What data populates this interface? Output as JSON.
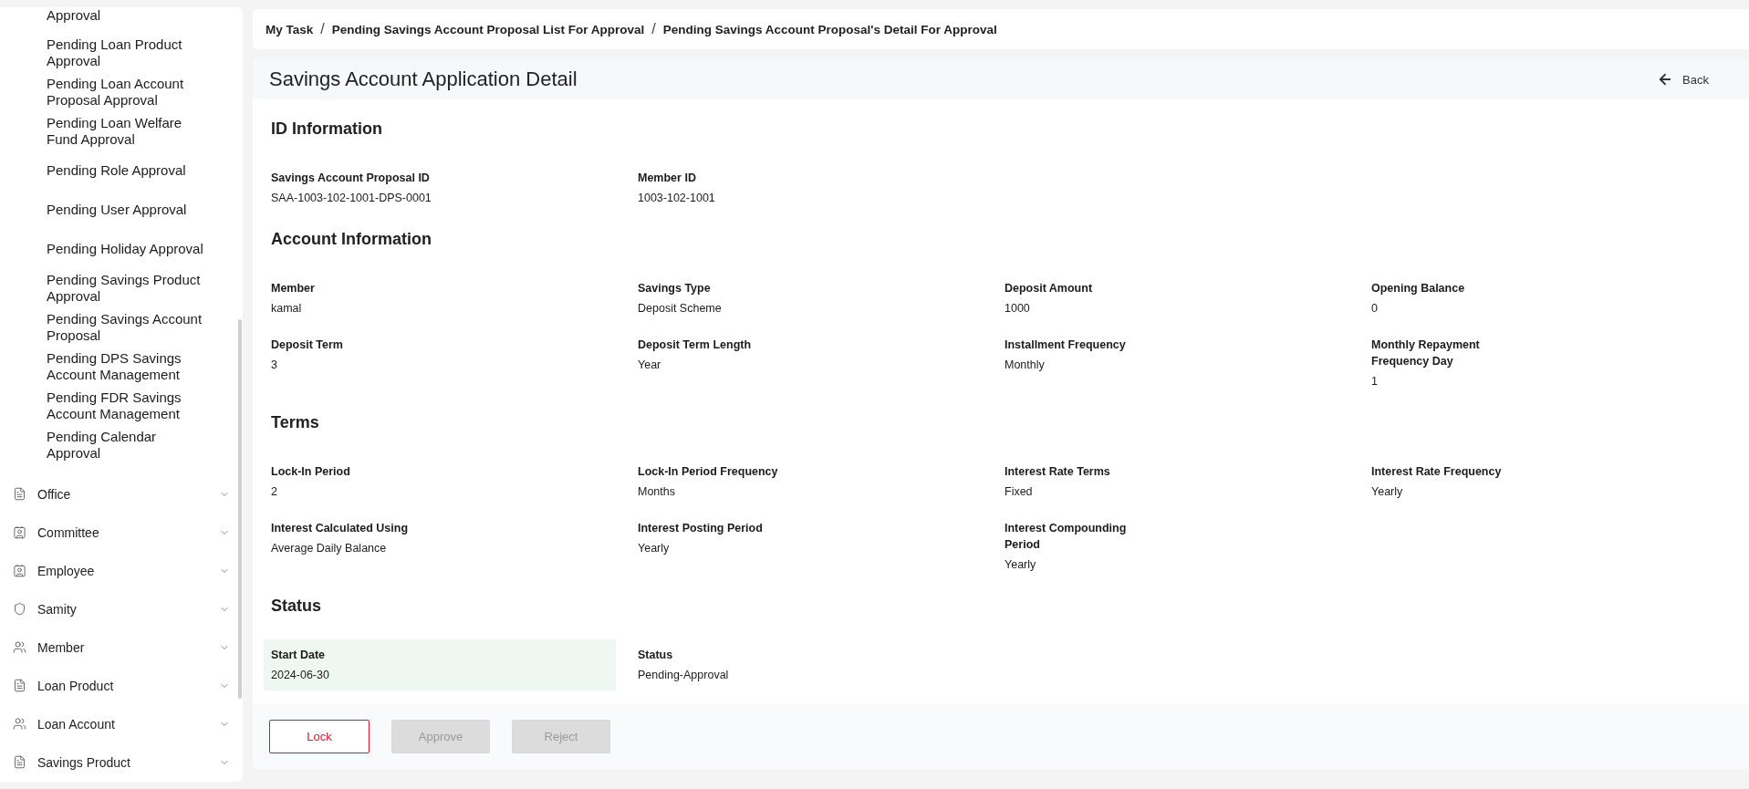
{
  "sidebar": {
    "sub_items": [
      {
        "label": "Approval"
      },
      {
        "label": "Pending Loan Product Approval"
      },
      {
        "label": "Pending Loan Account Proposal Approval"
      },
      {
        "label": "Pending Loan Welfare Fund Approval"
      },
      {
        "label": "Pending Role Approval"
      },
      {
        "label": "Pending User Approval"
      },
      {
        "label": "Pending Holiday Approval"
      },
      {
        "label": "Pending Savings Product Approval"
      },
      {
        "label": "Pending Savings Account Proposal"
      },
      {
        "label": "Pending DPS Savings Account Management"
      },
      {
        "label": "Pending FDR Savings Account Management"
      },
      {
        "label": "Pending Calendar Approval"
      }
    ],
    "items": [
      {
        "label": "Office",
        "kind": "document",
        "expanded": false
      },
      {
        "label": "Committee",
        "kind": "card",
        "expanded": false
      },
      {
        "label": "Employee",
        "kind": "card",
        "expanded": false
      },
      {
        "label": "Samity",
        "kind": "samity",
        "expanded": false
      },
      {
        "label": "Member",
        "kind": "group",
        "expanded": false
      },
      {
        "label": "Loan Product",
        "kind": "document",
        "expanded": false
      },
      {
        "label": "Loan Account",
        "kind": "group",
        "expanded": false
      },
      {
        "label": "Savings Product",
        "kind": "document",
        "expanded": false
      }
    ]
  },
  "breadcrumb": {
    "separator": "/",
    "items": [
      "My Task",
      "Pending Savings Account Proposal List For Approval",
      "Pending Savings Account Proposal's Detail For Approval"
    ]
  },
  "page": {
    "title": "Savings Account Application Detail",
    "back_label": "Back"
  },
  "sections": [
    {
      "title": "ID Information",
      "fields": [
        {
          "label": "Savings Account Proposal ID",
          "value": "SAA-1003-102-1001-DPS-0001",
          "highlighted": false
        },
        {
          "label": "Member ID",
          "value": "1003-102-1001",
          "highlighted": false
        }
      ]
    },
    {
      "title": "Account Information",
      "fields": [
        {
          "label": "Member",
          "value": "kamal",
          "highlighted": false
        },
        {
          "label": "Savings Type",
          "value": "Deposit Scheme",
          "highlighted": false
        },
        {
          "label": "Deposit Amount",
          "value": "1000",
          "highlighted": false
        },
        {
          "label": "Opening Balance",
          "value": "0",
          "highlighted": false
        },
        {
          "label": "Deposit Term",
          "value": "3",
          "highlighted": false
        },
        {
          "label": "Deposit Term Length",
          "value": "Year",
          "highlighted": false
        },
        {
          "label": "Installment Frequency",
          "value": "Monthly",
          "highlighted": false
        },
        {
          "label": "Monthly Repayment Frequency Day",
          "value": "1",
          "highlighted": false
        }
      ]
    },
    {
      "title": "Terms",
      "fields": [
        {
          "label": "Lock-In Period",
          "value": "2",
          "highlighted": false
        },
        {
          "label": "Lock-In Period Frequency",
          "value": "Months",
          "highlighted": false
        },
        {
          "label": "Interest Rate Terms",
          "value": "Fixed",
          "highlighted": false
        },
        {
          "label": "Interest Rate Frequency",
          "value": "Yearly",
          "highlighted": false
        },
        {
          "label": "Interest Calculated Using",
          "value": "Average Daily Balance",
          "highlighted": false
        },
        {
          "label": "Interest Posting Period",
          "value": "Yearly",
          "highlighted": false
        },
        {
          "label": "Interest Compounding Period",
          "value": "Yearly",
          "highlighted": false
        }
      ]
    },
    {
      "title": "Status",
      "fields": [
        {
          "label": "Start Date",
          "value": "2024-06-30",
          "highlighted": true
        },
        {
          "label": "Status",
          "value": "Pending-Approval",
          "highlighted": false
        }
      ]
    }
  ],
  "actions": [
    {
      "label": "Lock",
      "disabled": false
    },
    {
      "label": "Approve",
      "disabled": true
    },
    {
      "label": "Reject",
      "disabled": true
    }
  ]
}
